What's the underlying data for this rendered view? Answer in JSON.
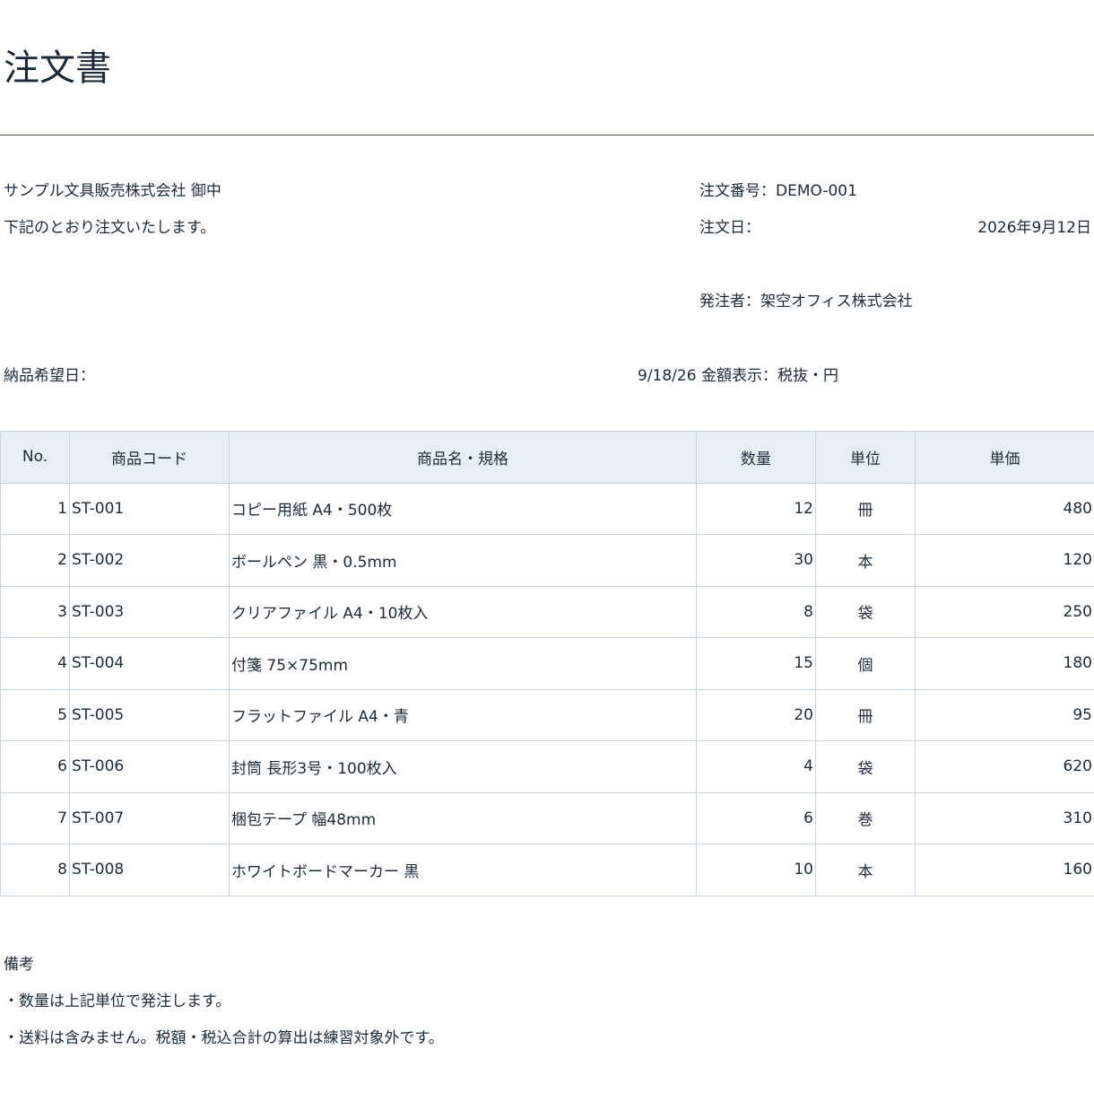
{
  "document": {
    "title": "注文書"
  },
  "header": {
    "recipient": "サンプル文具販売株式会社 御中",
    "greeting": "下記のとおり注文いたします。",
    "order_number_label": "注文番号：",
    "order_number": "DEMO-001",
    "order_date_label": "注文日：",
    "order_date": "2026年9月12日",
    "orderer_label": "発注者：",
    "orderer": "架空オフィス株式会社",
    "delivery_label": "納品希望日：",
    "delivery_date": "9/18/26",
    "amount_display": "金額表示：税抜・円"
  },
  "table": {
    "columns": [
      "No.",
      "商品コード",
      "商品名・規格",
      "数量",
      "単位",
      "単価"
    ],
    "rows": [
      {
        "no": "1",
        "code": "ST-001",
        "name": "コピー用紙 A4・500枚",
        "qty": "12",
        "unit": "冊",
        "price": "480"
      },
      {
        "no": "2",
        "code": "ST-002",
        "name": "ボールペン 黒・0.5mm",
        "qty": "30",
        "unit": "本",
        "price": "120"
      },
      {
        "no": "3",
        "code": "ST-003",
        "name": "クリアファイル A4・10枚入",
        "qty": "8",
        "unit": "袋",
        "price": "250"
      },
      {
        "no": "4",
        "code": "ST-004",
        "name": "付箋 75×75mm",
        "qty": "15",
        "unit": "個",
        "price": "180"
      },
      {
        "no": "5",
        "code": "ST-005",
        "name": "フラットファイル A4・青",
        "qty": "20",
        "unit": "冊",
        "price": "95"
      },
      {
        "no": "6",
        "code": "ST-006",
        "name": "封筒 長形3号・100枚入",
        "qty": "4",
        "unit": "袋",
        "price": "620"
      },
      {
        "no": "7",
        "code": "ST-007",
        "name": "梱包テープ 幅48mm",
        "qty": "6",
        "unit": "巻",
        "price": "310"
      },
      {
        "no": "8",
        "code": "ST-008",
        "name": "ホワイトボードマーカー 黒",
        "qty": "10",
        "unit": "本",
        "price": "160"
      }
    ]
  },
  "notes": {
    "heading": "備考",
    "lines": [
      "・数量は上記単位で発注します。",
      "・送料は含みません。税額・税込合計の算出は練習対象外です。"
    ]
  }
}
